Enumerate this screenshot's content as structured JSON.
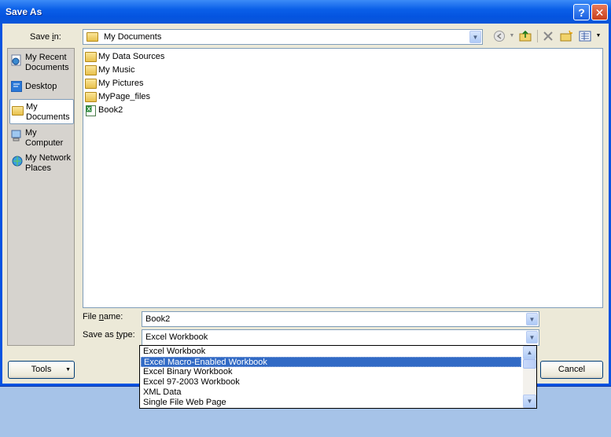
{
  "window": {
    "title": "Save As",
    "help_label": "?",
    "close_label": "✕"
  },
  "save_in": {
    "label_pre": "Save ",
    "label_key": "i",
    "label_post": "n:",
    "value": "My Documents"
  },
  "toolbar": {
    "back_icon": "back-icon",
    "up_icon": "up-folder-icon",
    "delete_icon": "delete-icon",
    "new_folder_icon": "new-folder-icon",
    "views_icon": "views-icon"
  },
  "places": [
    {
      "label_line1": "My Recent",
      "label_line2": "Documents",
      "icon": "recent-documents-icon"
    },
    {
      "label_line1": "Desktop",
      "label_line2": "",
      "icon": "desktop-icon"
    },
    {
      "label_line1": "My",
      "label_line2": "Documents",
      "icon": "my-documents-icon"
    },
    {
      "label_line1": "My",
      "label_line2": "Computer",
      "icon": "my-computer-icon"
    },
    {
      "label_line1": "My Network",
      "label_line2": "Places",
      "icon": "network-places-icon"
    }
  ],
  "files": [
    {
      "name": "My Data Sources",
      "icon": "data-sources-folder-icon"
    },
    {
      "name": "My Music",
      "icon": "music-folder-icon"
    },
    {
      "name": "My Pictures",
      "icon": "pictures-folder-icon"
    },
    {
      "name": "MyPage_files",
      "icon": "folder-icon"
    },
    {
      "name": "Book2",
      "icon": "excel-file-icon"
    }
  ],
  "file_name": {
    "label_pre": "File ",
    "label_key": "n",
    "label_post": "ame:",
    "value": "Book2"
  },
  "save_as_type": {
    "label_pre": "Save as ",
    "label_key": "t",
    "label_post": "ype:",
    "value": "Excel Workbook"
  },
  "type_options": [
    "Excel Workbook",
    "Excel Macro-Enabled Workbook",
    "Excel Binary Workbook",
    "Excel 97-2003 Workbook",
    "XML Data",
    "Single File Web Page"
  ],
  "buttons": {
    "tools": "Tools",
    "cancel": "Cancel"
  }
}
